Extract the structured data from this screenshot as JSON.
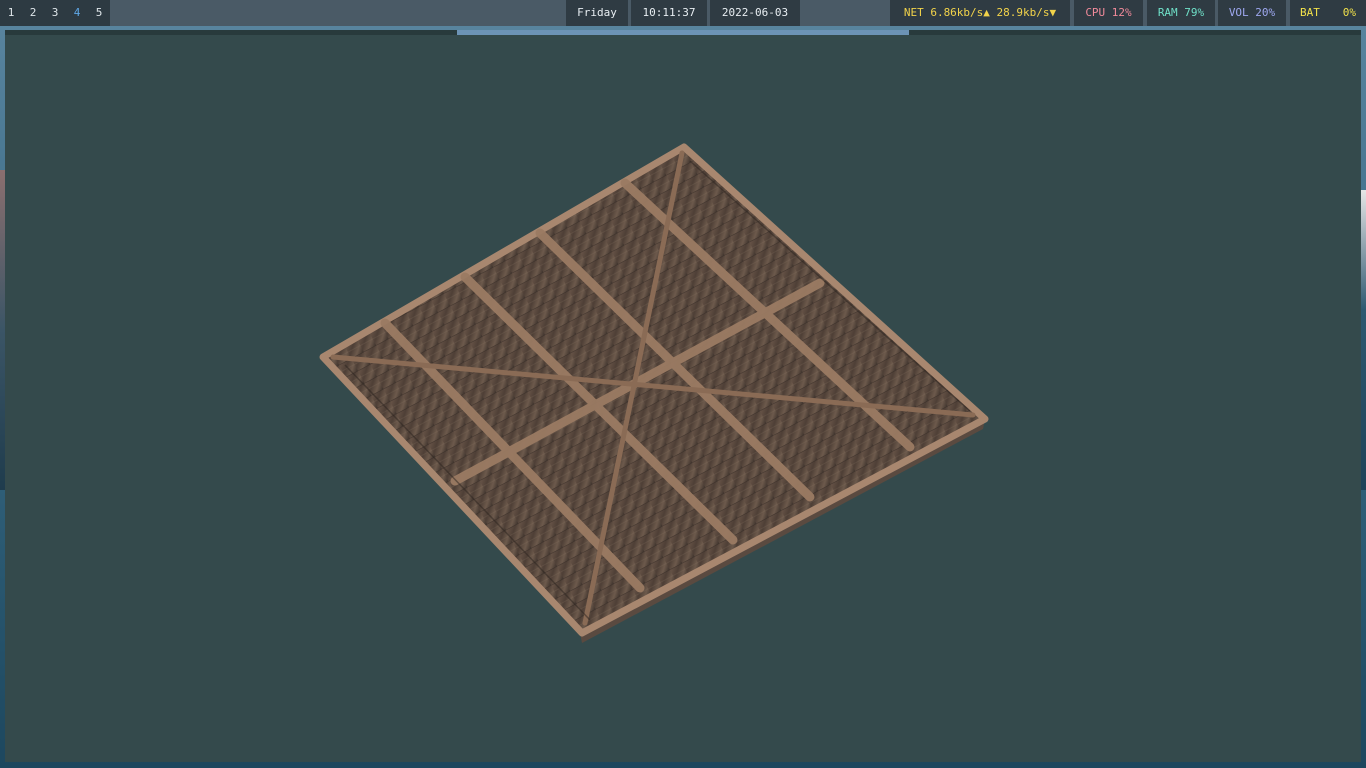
{
  "workspaces": [
    {
      "label": "1",
      "active": false
    },
    {
      "label": "2",
      "active": false
    },
    {
      "label": "3",
      "active": false
    },
    {
      "label": "4",
      "active": true
    },
    {
      "label": "5",
      "active": false
    }
  ],
  "status": {
    "day": "Friday",
    "time": "10:11:37",
    "date": "2022-06-03",
    "net": "NET 6.86kb/s▲ 28.9kb/s▼",
    "cpu": "CPU 12%",
    "ram": "RAM 79%",
    "vol": "VOL 20%",
    "bat_label": "BAT",
    "bat_value": "0%"
  },
  "colors": {
    "workspace_active": "#5fa8e8",
    "net": "#f2d34a",
    "cpu": "#f08a9a",
    "ram": "#6fe0c8",
    "vol": "#9ea8f0",
    "bat": "#f2e24a",
    "viewport_bg": "#344a4c",
    "focus_border": "#6c93b5"
  },
  "viewport": {
    "object": "wooden-pallet-model"
  }
}
